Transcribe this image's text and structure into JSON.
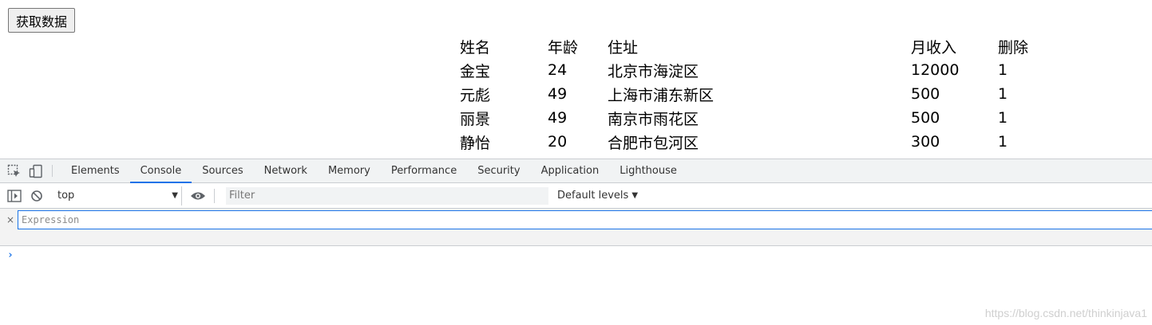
{
  "page": {
    "fetch_button": "获取数据",
    "table": {
      "headers": [
        "姓名",
        "年龄",
        "住址",
        "月收入",
        "删除"
      ],
      "rows": [
        [
          "金宝",
          "24",
          "北京市海淀区",
          "12000",
          "1"
        ],
        [
          "元彪",
          "49",
          "上海市浦东新区",
          "500",
          "1"
        ],
        [
          "丽景",
          "49",
          "南京市雨花区",
          "500",
          "1"
        ],
        [
          "静怡",
          "20",
          "合肥市包河区",
          "300",
          "1"
        ]
      ]
    }
  },
  "devtools": {
    "tabs": [
      "Elements",
      "Console",
      "Sources",
      "Network",
      "Memory",
      "Performance",
      "Security",
      "Application",
      "Lighthouse"
    ],
    "active_tab": "Console",
    "toolbar": {
      "context": "top",
      "filter_placeholder": "Filter",
      "levels": "Default levels"
    },
    "watch": {
      "close": "×",
      "expression_placeholder": "Expression"
    },
    "prompt": "›"
  },
  "watermark": "https://blog.csdn.net/thinkinjava1",
  "colors": {
    "accent": "#1a73e8",
    "devtools_bg": "#f1f3f4",
    "border": "#cacdd1"
  }
}
